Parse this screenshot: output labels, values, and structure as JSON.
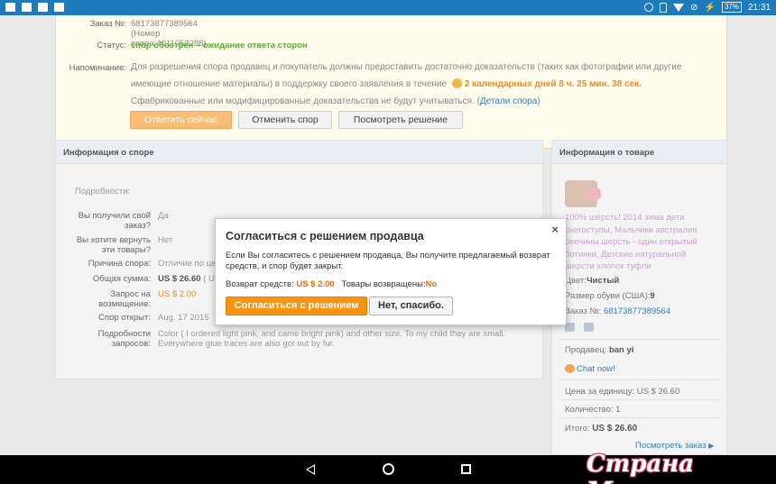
{
  "status_bar": {
    "battery": "37%",
    "time": "21:31"
  },
  "order": {
    "order_label": "Заказ №:",
    "order_value": "68173877389564 (Номер спора:4011052288)",
    "status_label": "Статус:",
    "status_value": "спор обострён – ожидание ответа сторон",
    "reminder_label": "Напоминание:",
    "reminder_text": "Для разрешения спора продавец и покупатель должны предоставить достаточно доказательств (таких как фотографии или другие имеющие отношение материалы) в поддержку своего заявления в течение",
    "deadline": "2 календарных дней 8 ч. 25 мин. 38 сек.",
    "reminder_tail": "Сфабрикованные или модифицированные доказательства не будут учитываться. (",
    "details_link": "Детали спора",
    "reminder_close": ")",
    "buttons": {
      "reply": "Ответить сейчас",
      "cancel": "Отменить спор",
      "view": "Посмотреть решение"
    }
  },
  "dispute": {
    "title": "Информация о споре",
    "details_label": "Подробности:",
    "rows": [
      {
        "label": "Вы получили свой заказ?",
        "value": "Да"
      },
      {
        "label": "Вы хотите вернуть эти товары?",
        "value": "Нет"
      },
      {
        "label": "Причина спора:",
        "value": "Отличие по цв"
      },
      {
        "label": "Общая сумма:",
        "value": "US $ 26.60",
        "extra": "( US"
      },
      {
        "label": "Запрос на возмещение:",
        "value": "US $ 2.00"
      },
      {
        "label": "Спор открыт:",
        "value": "Aug. 17 2015"
      },
      {
        "label": "Подробности запросов:",
        "value": "Color ( I ordered light pink, and came bright pink) and other size. To my child they are small. Everywhere glue traces are also got out by fur."
      }
    ]
  },
  "product": {
    "title": "Информация о товаре",
    "name": "100% шерсть! 2014 зима дети снегоступы, Мальчики австралия овечины шерсть - один открытый ботинки, Детские натуральной шерсти хлопок туфли",
    "color_label": "Цвет:",
    "color_value": "Чистый",
    "size_label": "Размер обуви (США):",
    "size_value": "9",
    "order_label": "Заказ №:",
    "order_value": "68173877389564",
    "seller_label": "Продавец:",
    "seller_value": "ban yi",
    "chat": "Chat now!",
    "unit_price_label": "Цена за единицу:",
    "unit_price_value": "US $ 26.60",
    "qty_label": "Количество:",
    "qty_value": "1",
    "total_label": "Итого:",
    "total_value": "US $ 26.60",
    "view_order": "Посмотреть заказ"
  },
  "modal": {
    "title": "Согласиться с решением продавца",
    "close": "×",
    "text": "Если Вы согласитесь с решением продавца, Вы получите предлагаемый возврат средств, и спор будет закрыт.",
    "refund_label": "Возврат средств:",
    "refund_value": "US $ 2.00",
    "returned_label": "Товары возвращены:",
    "returned_value": "No",
    "agree_button": "Согласиться с решением",
    "decline_button": "Нет, спасибо."
  },
  "watermark": "Страна Мам.ру"
}
